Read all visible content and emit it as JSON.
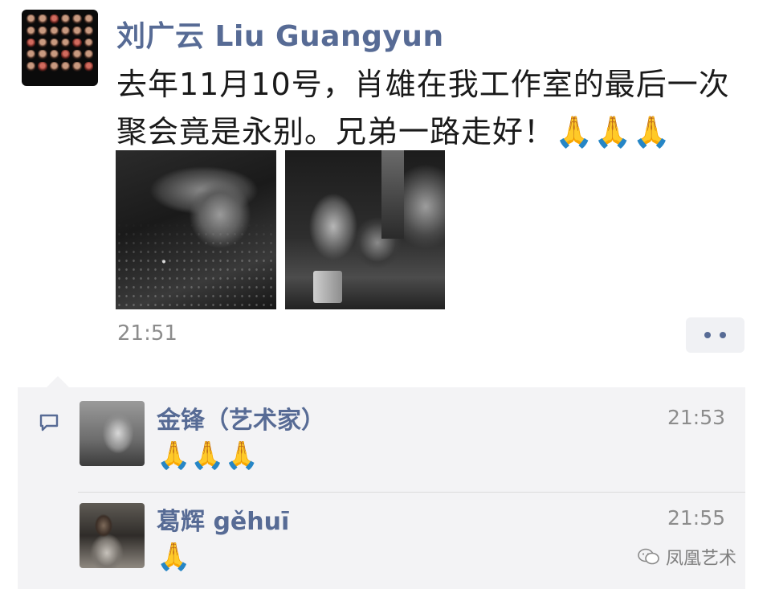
{
  "post": {
    "author": "刘广云 Liu Guangyun",
    "text": "去年11月10号，肖雄在我工作室的最后一次聚会竟是永别。兄弟一路走好！🙏🙏🙏",
    "time": "21:51"
  },
  "comments": [
    {
      "name": "金锋（艺术家）",
      "time": "21:53",
      "text": "🙏🙏🙏"
    },
    {
      "name": "葛辉 gěhuī",
      "time": "21:55",
      "text": "🙏"
    }
  ],
  "watermark": {
    "text": "凤凰艺术"
  }
}
